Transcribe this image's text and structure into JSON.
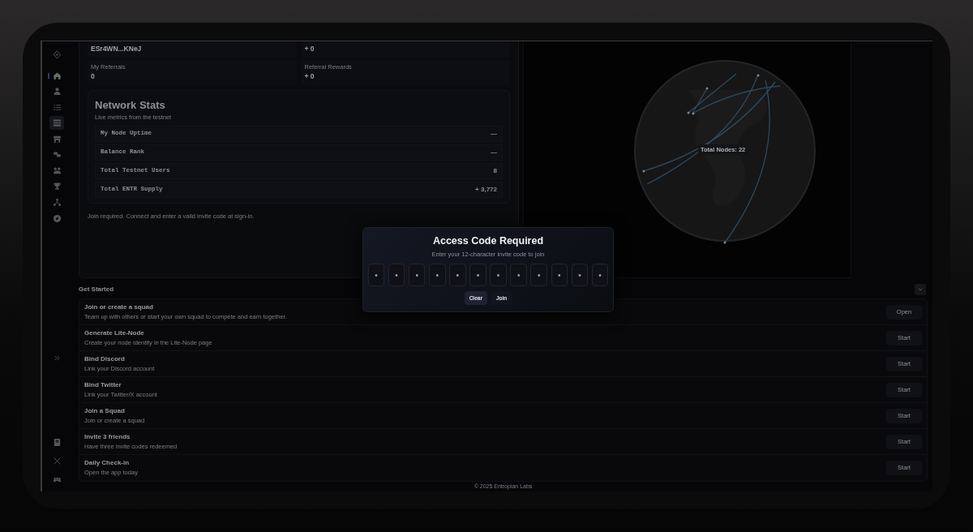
{
  "sidebar": {
    "items": [
      {
        "selected": false,
        "hovered": false
      },
      {
        "selected": true,
        "hovered": false
      },
      {
        "selected": false,
        "hovered": false
      },
      {
        "selected": false,
        "hovered": false
      },
      {
        "selected": false,
        "hovered": true
      },
      {
        "selected": false,
        "hovered": false
      },
      {
        "selected": false,
        "hovered": false
      },
      {
        "selected": false,
        "hovered": false
      },
      {
        "selected": false,
        "hovered": false
      },
      {
        "selected": false,
        "hovered": false
      },
      {
        "selected": false,
        "hovered": false
      }
    ]
  },
  "account": {
    "stats": [
      {
        "value": "ESr4WN...KNeJ"
      },
      {
        "value": "+ 0"
      },
      {
        "label": "My Referrals",
        "value": "0"
      },
      {
        "label": "Referral Rewards",
        "value": "+ 0"
      }
    ]
  },
  "network_stats": {
    "title": "Network Stats",
    "subtitle": "Live metrics from the testnet",
    "rows": [
      {
        "label": "My Node Uptime",
        "value": "—"
      },
      {
        "label": "Balance Rank",
        "value": "—"
      },
      {
        "label": "Total Testnet Users",
        "value": "8"
      },
      {
        "label": "Total ENTR Supply",
        "value": "+ 3,772"
      }
    ]
  },
  "note": "Join required. Connect and enter a valid invite code at sign-in.",
  "globe": {
    "label": "Total Nodes: 22"
  },
  "get_started": {
    "title": "Get Started",
    "expanded": true,
    "tasks": [
      {
        "title": "Join or create a squad",
        "description": "Team up with others or start your own squad to compete and earn together.",
        "action": "Open"
      },
      {
        "title": "Generate Lite-Node",
        "description": "Create your node identity in the Lite-Node page",
        "action": "Start"
      },
      {
        "title": "Bind Discord",
        "description": "Link your Discord account",
        "action": "Start"
      },
      {
        "title": "Bind Twitter",
        "description": "Link your Twitter/X account",
        "action": "Start"
      },
      {
        "title": "Join a Squad",
        "description": "Join or create a squad",
        "action": "Start"
      },
      {
        "title": "Invite 3 friends",
        "description": "Have three invite codes redeemed",
        "action": "Start"
      },
      {
        "title": "Daily Check-in",
        "description": "Open the app today",
        "action": "Start"
      }
    ]
  },
  "footer": "© 2025 Entropian Labs",
  "modal": {
    "title": "Access Code Required",
    "subtitle": "Enter your 12-character invite code to join",
    "code_boxes": [
      {
        "placeholder": "•"
      },
      {
        "placeholder": "•"
      },
      {
        "placeholder": "•"
      },
      {
        "placeholder": "•"
      },
      {
        "placeholder": "•"
      },
      {
        "placeholder": "•"
      },
      {
        "placeholder": "•"
      },
      {
        "placeholder": "•"
      },
      {
        "placeholder": "•"
      },
      {
        "placeholder": "•"
      },
      {
        "placeholder": "•"
      },
      {
        "placeholder": "•"
      }
    ],
    "buttons": [
      {
        "label": "Clear",
        "primary": true
      },
      {
        "label": "Join",
        "primary": false
      }
    ]
  }
}
